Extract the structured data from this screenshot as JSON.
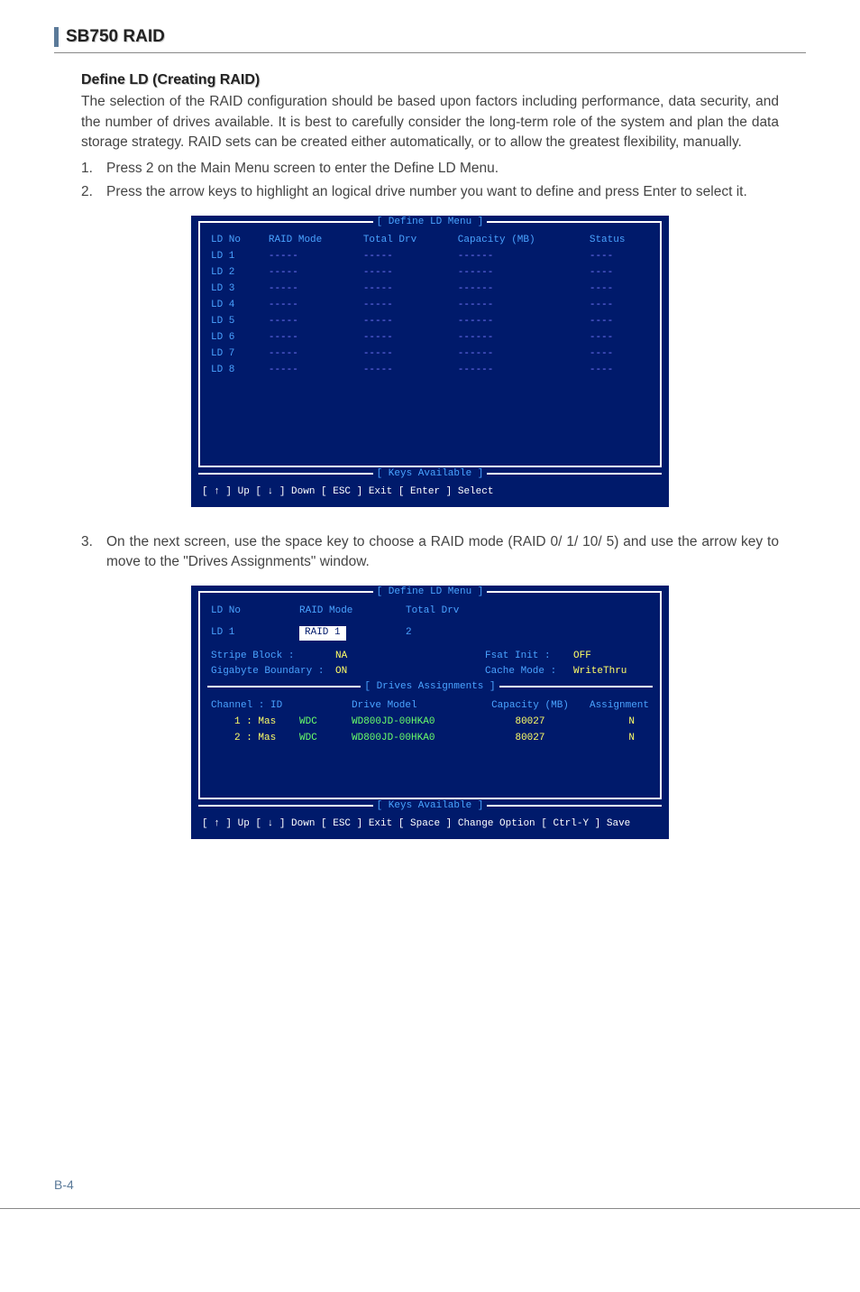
{
  "chapter": "SB750 RAID",
  "section_title": "Define LD (Creating RAID)",
  "intro": "The selection of the RAID configuration should be based upon factors including performance, data security, and the number of drives available. It is best to carefully consider the long-term role of the system and plan the data storage strategy. RAID sets can be created either automatically, or to allow the greatest flexibility, manually.",
  "steps": {
    "s1": "Press 2 on the Main Menu screen to enter the Define LD Menu.",
    "s2": "Press the arrow keys to highlight an logical drive number you want to define and press Enter to select it.",
    "s3": "On the next screen, use the space key to choose a RAID mode (RAID 0/ 1/ 10/ 5) and use the arrow key to move to the \"Drives Assignments\" window."
  },
  "bios1": {
    "title": "[ Define LD Menu ]",
    "headers": {
      "ld_no": "LD No",
      "raid_mode": "RAID Mode",
      "total_drv": "Total Drv",
      "capacity": "Capacity (MB)",
      "status": "Status"
    },
    "rows": [
      {
        "ld": "LD  1",
        "mode": "-----",
        "drv": "-----",
        "cap": "------",
        "st": "----"
      },
      {
        "ld": "LD  2",
        "mode": "-----",
        "drv": "-----",
        "cap": "------",
        "st": "----"
      },
      {
        "ld": "LD  3",
        "mode": "-----",
        "drv": "-----",
        "cap": "------",
        "st": "----"
      },
      {
        "ld": "LD  4",
        "mode": "-----",
        "drv": "-----",
        "cap": "------",
        "st": "----"
      },
      {
        "ld": "LD  5",
        "mode": "-----",
        "drv": "-----",
        "cap": "------",
        "st": "----"
      },
      {
        "ld": "LD  6",
        "mode": "-----",
        "drv": "-----",
        "cap": "------",
        "st": "----"
      },
      {
        "ld": "LD  7",
        "mode": "-----",
        "drv": "-----",
        "cap": "------",
        "st": "----"
      },
      {
        "ld": "LD  8",
        "mode": "-----",
        "drv": "-----",
        "cap": "------",
        "st": "----"
      }
    ],
    "keys_title": "[ Keys Available ]",
    "keys": "[ ↑ ] Up     [ ↓ ] Down     [ ESC ] Exit     [ Enter ] Select"
  },
  "bios2": {
    "title": "[ Define LD Menu ]",
    "ld_no_h": "LD No",
    "raid_mode_h": "RAID Mode",
    "total_drv_h": "Total Drv",
    "ld_row": {
      "ld": "LD  1",
      "mode": "RAID 1",
      "drv": "2"
    },
    "stripe_block_l": "Stripe Block :",
    "stripe_block_v": "NA",
    "gigabyte_l": "Gigabyte Boundary :",
    "gigabyte_v": "ON",
    "fsat_init_l": "Fsat Init :",
    "fsat_init_v": "OFF",
    "cache_mode_l": "Cache Mode :",
    "cache_mode_v": "WriteThru",
    "assign_title": "[ Drives Assignments ]",
    "assign_headers": {
      "ch": "Channel : ID",
      "model": "Drive Model",
      "cap": "Capacity (MB)",
      "asg": "Assignment"
    },
    "assign_rows": [
      {
        "ch": "1 : Mas",
        "vendor": "WDC",
        "model": "WD800JD-00HKA0",
        "cap": "80027",
        "asg": "N"
      },
      {
        "ch": "2 : Mas",
        "vendor": "WDC",
        "model": "WD800JD-00HKA0",
        "cap": "80027",
        "asg": "N"
      }
    ],
    "keys_title": "[ Keys Available ]",
    "keys": "[ ↑ ] Up    [ ↓ ] Down    [ ESC ] Exit    [ Space ] Change Option    [ Ctrl-Y ] Save"
  },
  "page_num": "B-4"
}
